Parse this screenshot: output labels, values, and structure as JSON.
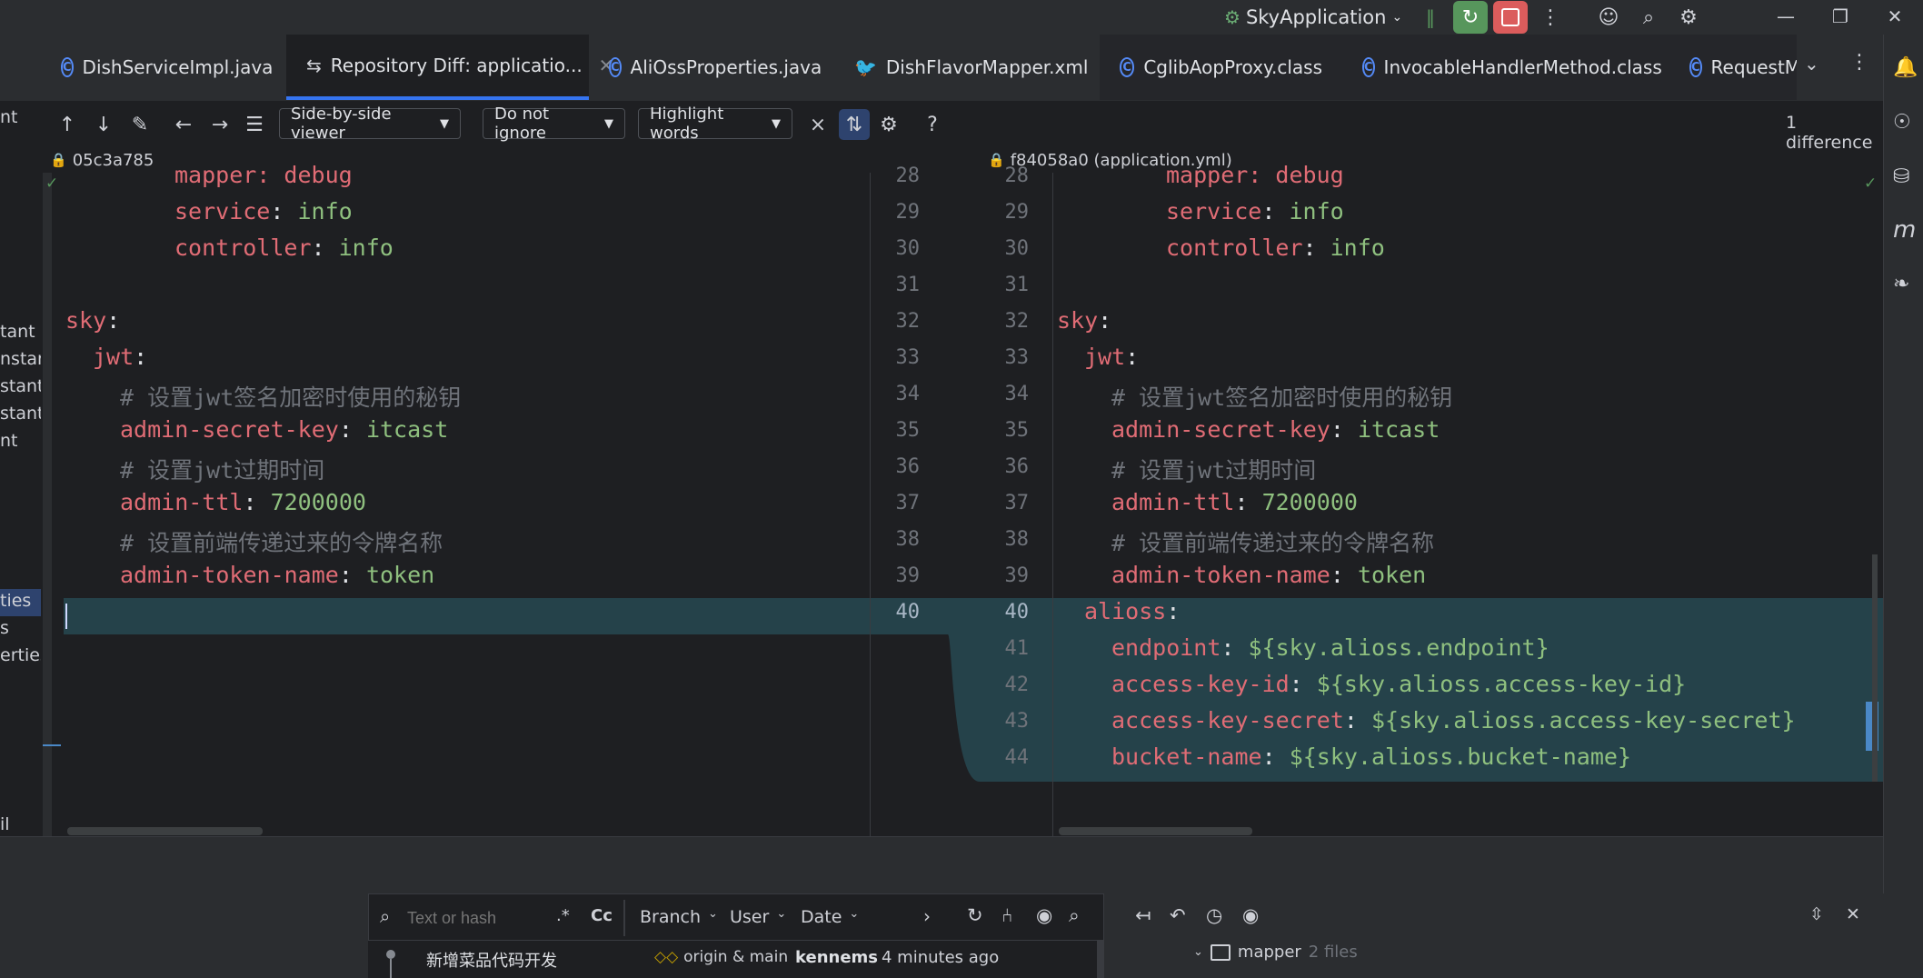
{
  "run_config": "SkyApplication",
  "tabs": [
    {
      "label": "DishServiceImpl.java"
    },
    {
      "label": "Repository Diff: applicatio..."
    },
    {
      "label": "AliOssProperties.java"
    },
    {
      "label": "DishFlavorMapper.xml"
    },
    {
      "label": "CglibAopProxy.class"
    },
    {
      "label": "InvocableHandlerMethod.class"
    },
    {
      "label": "RequestM"
    }
  ],
  "left_panel_labels": [
    "nt",
    "tant",
    "nstan",
    "stant",
    "stant",
    "nt",
    "ties",
    "s",
    "erties",
    "il"
  ],
  "toolbar": {
    "viewer": "Side-by-side viewer",
    "ignore": "Do not ignore",
    "highlight": "Highlight words",
    "help": "?",
    "differences": "1 difference"
  },
  "left_header": "05c3a785",
  "right_header": "f84058a0 (application.yml)",
  "left_code": [
    {
      "n": "28",
      "t": "mapper: debug"
    },
    {
      "n": "29",
      "t": "service: info"
    },
    {
      "n": "30",
      "t": "controller: info"
    },
    {
      "n": "31",
      "t": ""
    },
    {
      "n": "32",
      "t": "sky:"
    },
    {
      "n": "33",
      "t": "jwt:"
    },
    {
      "n": "34",
      "t": "# 设置jwt签名加密时使用的秘钥"
    },
    {
      "n": "35",
      "t": "admin-secret-key: itcast"
    },
    {
      "n": "36",
      "t": "# 设置jwt过期时间"
    },
    {
      "n": "37",
      "t": "admin-ttl: 7200000"
    },
    {
      "n": "38",
      "t": "# 设置前端传递过来的令牌名称"
    },
    {
      "n": "39",
      "t": "admin-token-name: token"
    },
    {
      "n": "40",
      "t": ""
    }
  ],
  "right_code": [
    {
      "n": "28",
      "t": "mapper: debug"
    },
    {
      "n": "29",
      "t": "service: info"
    },
    {
      "n": "30",
      "t": "controller: info"
    },
    {
      "n": "31",
      "t": ""
    },
    {
      "n": "32",
      "t": "sky:"
    },
    {
      "n": "33",
      "t": "jwt:"
    },
    {
      "n": "34",
      "t": "# 设置jwt签名加密时使用的秘钥"
    },
    {
      "n": "35",
      "t": "admin-secret-key: itcast"
    },
    {
      "n": "36",
      "t": "# 设置jwt过期时间"
    },
    {
      "n": "37",
      "t": "admin-ttl: 7200000"
    },
    {
      "n": "38",
      "t": "# 设置前端传递过来的令牌名称"
    },
    {
      "n": "39",
      "t": "admin-token-name: token"
    },
    {
      "n": "40",
      "t": "alioss:"
    },
    {
      "n": "41",
      "t": "endpoint: ${sky.alioss.endpoint}"
    },
    {
      "n": "42",
      "t": "access-key-id: ${sky.alioss.access-key-id}"
    },
    {
      "n": "43",
      "t": "access-key-secret: ${sky.alioss.access-key-secret}"
    },
    {
      "n": "44",
      "t": "bucket-name: ${sky.alioss.bucket-name}"
    }
  ],
  "git": {
    "search_placeholder": "Text or hash",
    "regex": ".*",
    "case": "Cc",
    "branch": "Branch",
    "user": "User",
    "date": "Date",
    "commit_message": "新增菜品代码开发",
    "commit_refs": "origin & main",
    "commit_author": "kennems",
    "commit_time": "4 minutes ago",
    "tree_folder": "mapper",
    "tree_count": "2 files"
  },
  "colors": {
    "diff_added_bg": "#25424a",
    "key": "#e06c75",
    "value": "#8fc07f",
    "comment": "#6f737a",
    "accent": "#3574f0"
  }
}
